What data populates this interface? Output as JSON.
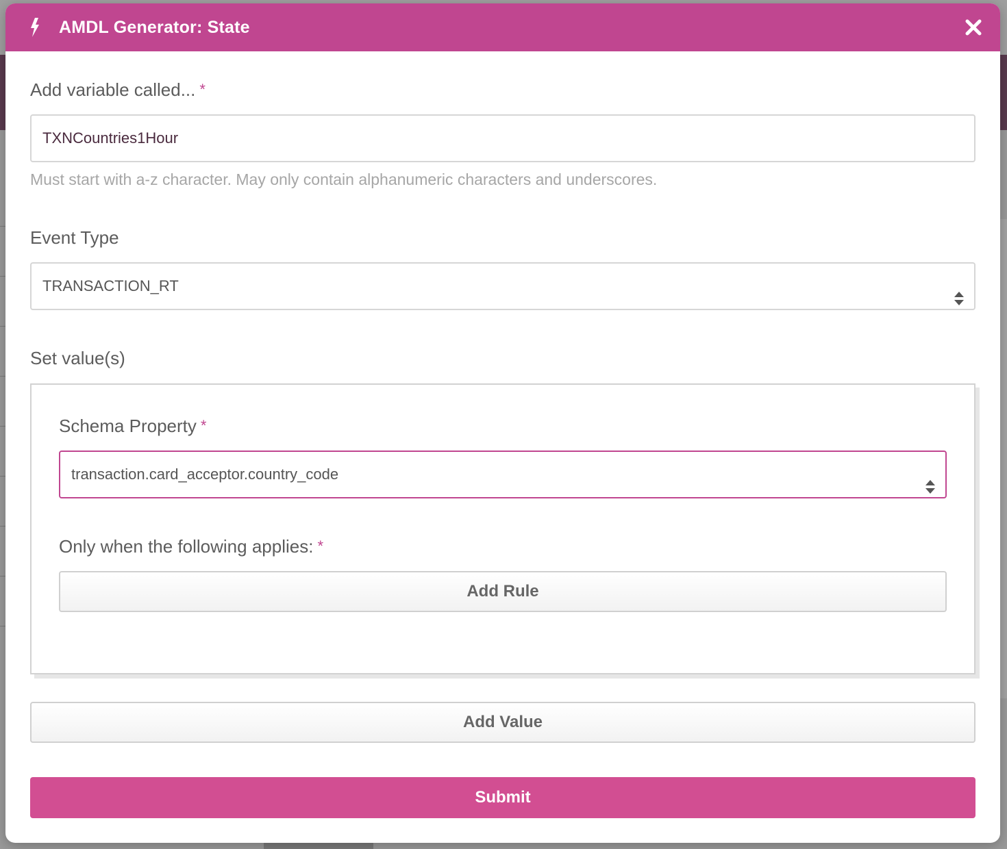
{
  "modal": {
    "title": "AMDL Generator: State",
    "header_color": "#c04690"
  },
  "variable": {
    "label": "Add variable called...",
    "required_mark": "*",
    "value": "TXNCountries1Hour",
    "help": "Must start with a-z character. May only contain alphanumeric characters and underscores."
  },
  "event_type": {
    "label": "Event Type",
    "selected": "TRANSACTION_RT"
  },
  "set_values": {
    "label": "Set value(s)",
    "schema_property": {
      "label": "Schema Property",
      "required_mark": "*",
      "selected": "transaction.card_acceptor.country_code"
    },
    "condition": {
      "label": "Only when the following applies:",
      "required_mark": "*",
      "add_rule_label": "Add Rule"
    }
  },
  "actions": {
    "add_value_label": "Add Value",
    "submit_label": "Submit",
    "submit_color": "#d24e92"
  },
  "icons": {
    "header": "lightning-bolt-icon",
    "close": "close-icon",
    "select": "sort-arrows-icon"
  }
}
